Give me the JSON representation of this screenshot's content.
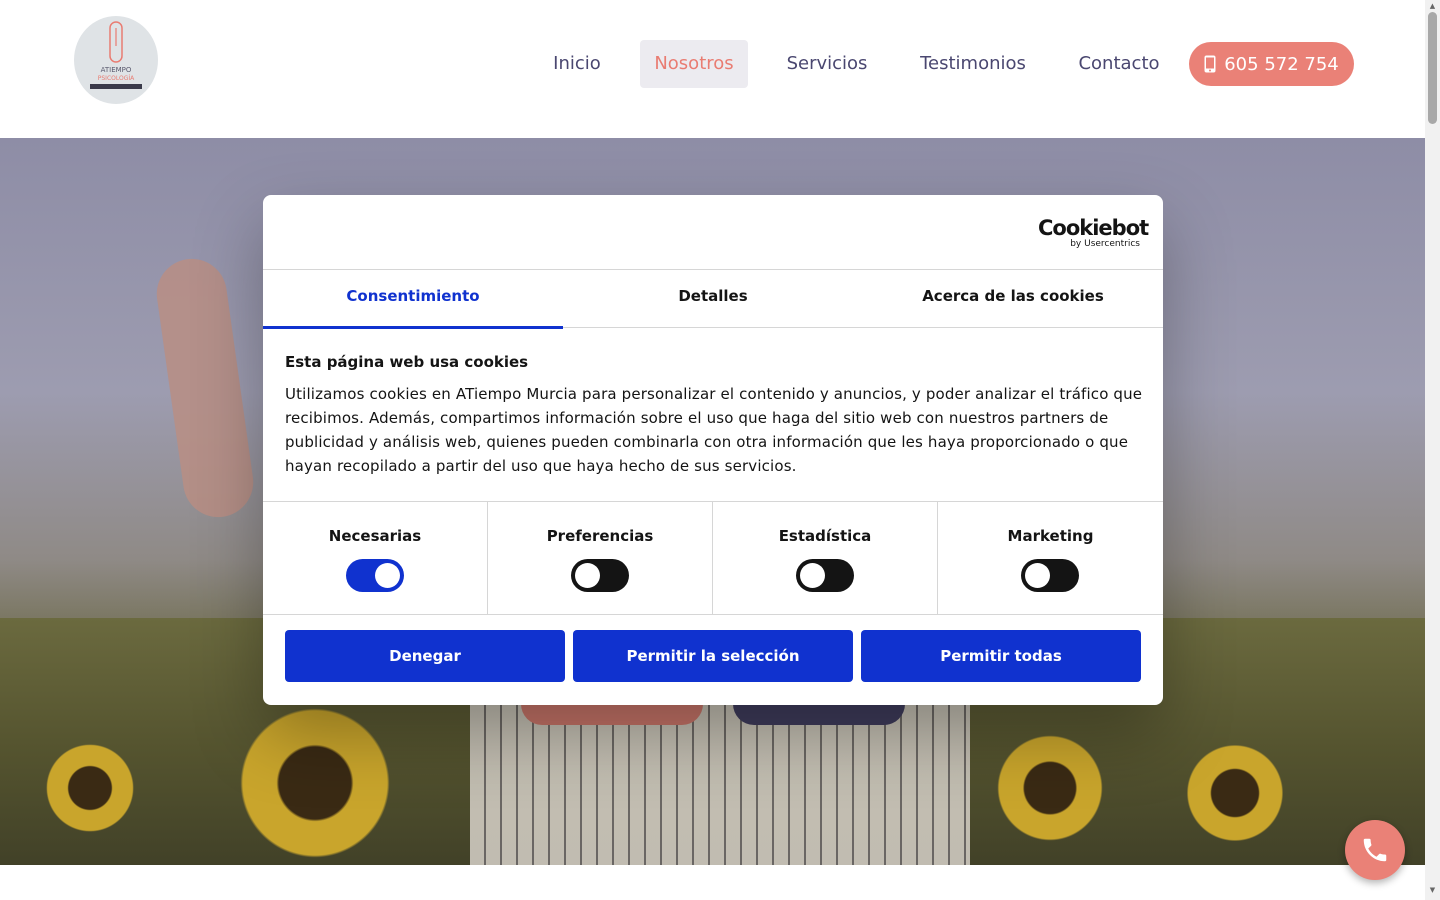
{
  "header": {
    "logo": {
      "line1": "ATIEMPO",
      "line2": "PSICOLOGÍA"
    },
    "nav": [
      {
        "label": "Inicio",
        "active": false
      },
      {
        "label": "Nosotros",
        "active": true
      },
      {
        "label": "Servicios",
        "active": false
      },
      {
        "label": "Testimonios",
        "active": false
      },
      {
        "label": "Contacto",
        "active": false
      }
    ],
    "phone": "605 572 754"
  },
  "cookie_dialog": {
    "brand": "Cookiebot",
    "brand_sub": "by Usercentrics",
    "tabs": [
      {
        "label": "Consentimiento",
        "active": true
      },
      {
        "label": "Detalles",
        "active": false
      },
      {
        "label": "Acerca de las cookies",
        "active": false
      }
    ],
    "title": "Esta página web usa cookies",
    "body": "Utilizamos cookies en ATiempo Murcia para personalizar el contenido y anuncios, y poder analizar el tráfico que recibimos. Además, compartimos información sobre el uso que haga del sitio web con nuestros partners de publicidad y análisis web, quienes pueden combinarla con otra información que les haya proporcionado o que hayan recopilado a partir del uso que haya hecho de sus servicios.",
    "categories": [
      {
        "label": "Necesarias",
        "enabled": true
      },
      {
        "label": "Preferencias",
        "enabled": false
      },
      {
        "label": "Estadística",
        "enabled": false
      },
      {
        "label": "Marketing",
        "enabled": false
      }
    ],
    "buttons": {
      "deny": "Denegar",
      "allow_selection": "Permitir la selección",
      "allow_all": "Permitir todas"
    }
  },
  "icons": {
    "phone": "mobile-phone-icon",
    "call_fab": "phone-handset-icon"
  },
  "colors": {
    "accent": "#ea8177",
    "nav_text": "#4a4770",
    "cookie_blue": "#1032cf"
  }
}
